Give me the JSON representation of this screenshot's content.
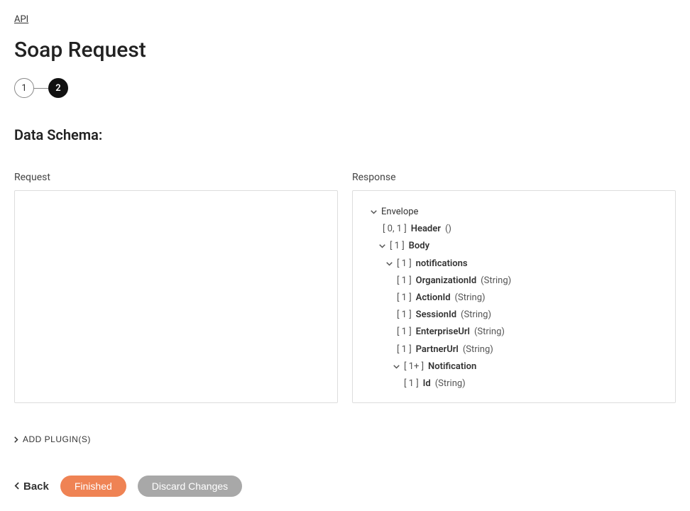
{
  "breadcrumb": {
    "api": "API"
  },
  "page_title": "Soap Request",
  "stepper": {
    "step1": "1",
    "step2": "2"
  },
  "section_title": "Data Schema:",
  "request": {
    "label": "Request"
  },
  "response": {
    "label": "Response",
    "tree": {
      "envelope": {
        "name": "Envelope"
      },
      "header": {
        "card": "[ 0, 1 ]",
        "name": "Header",
        "type": "()"
      },
      "body": {
        "card": "[ 1 ]",
        "name": "Body"
      },
      "notifications": {
        "card": "[ 1 ]",
        "name": "notifications"
      },
      "orgId": {
        "card": "[ 1 ]",
        "name": "OrganizationId",
        "type": "(String)"
      },
      "actionId": {
        "card": "[ 1 ]",
        "name": "ActionId",
        "type": "(String)"
      },
      "sessionId": {
        "card": "[ 1 ]",
        "name": "SessionId",
        "type": "(String)"
      },
      "entUrl": {
        "card": "[ 1 ]",
        "name": "EnterpriseUrl",
        "type": "(String)"
      },
      "partUrl": {
        "card": "[ 1 ]",
        "name": "PartnerUrl",
        "type": "(String)"
      },
      "notification": {
        "card": "[ 1+ ]",
        "name": "Notification"
      },
      "id": {
        "card": "[ 1 ]",
        "name": "Id",
        "type": "(String)"
      }
    }
  },
  "add_plugin": "ADD PLUGIN(S)",
  "buttons": {
    "back": "Back",
    "finished": "Finished",
    "discard": "Discard Changes"
  }
}
